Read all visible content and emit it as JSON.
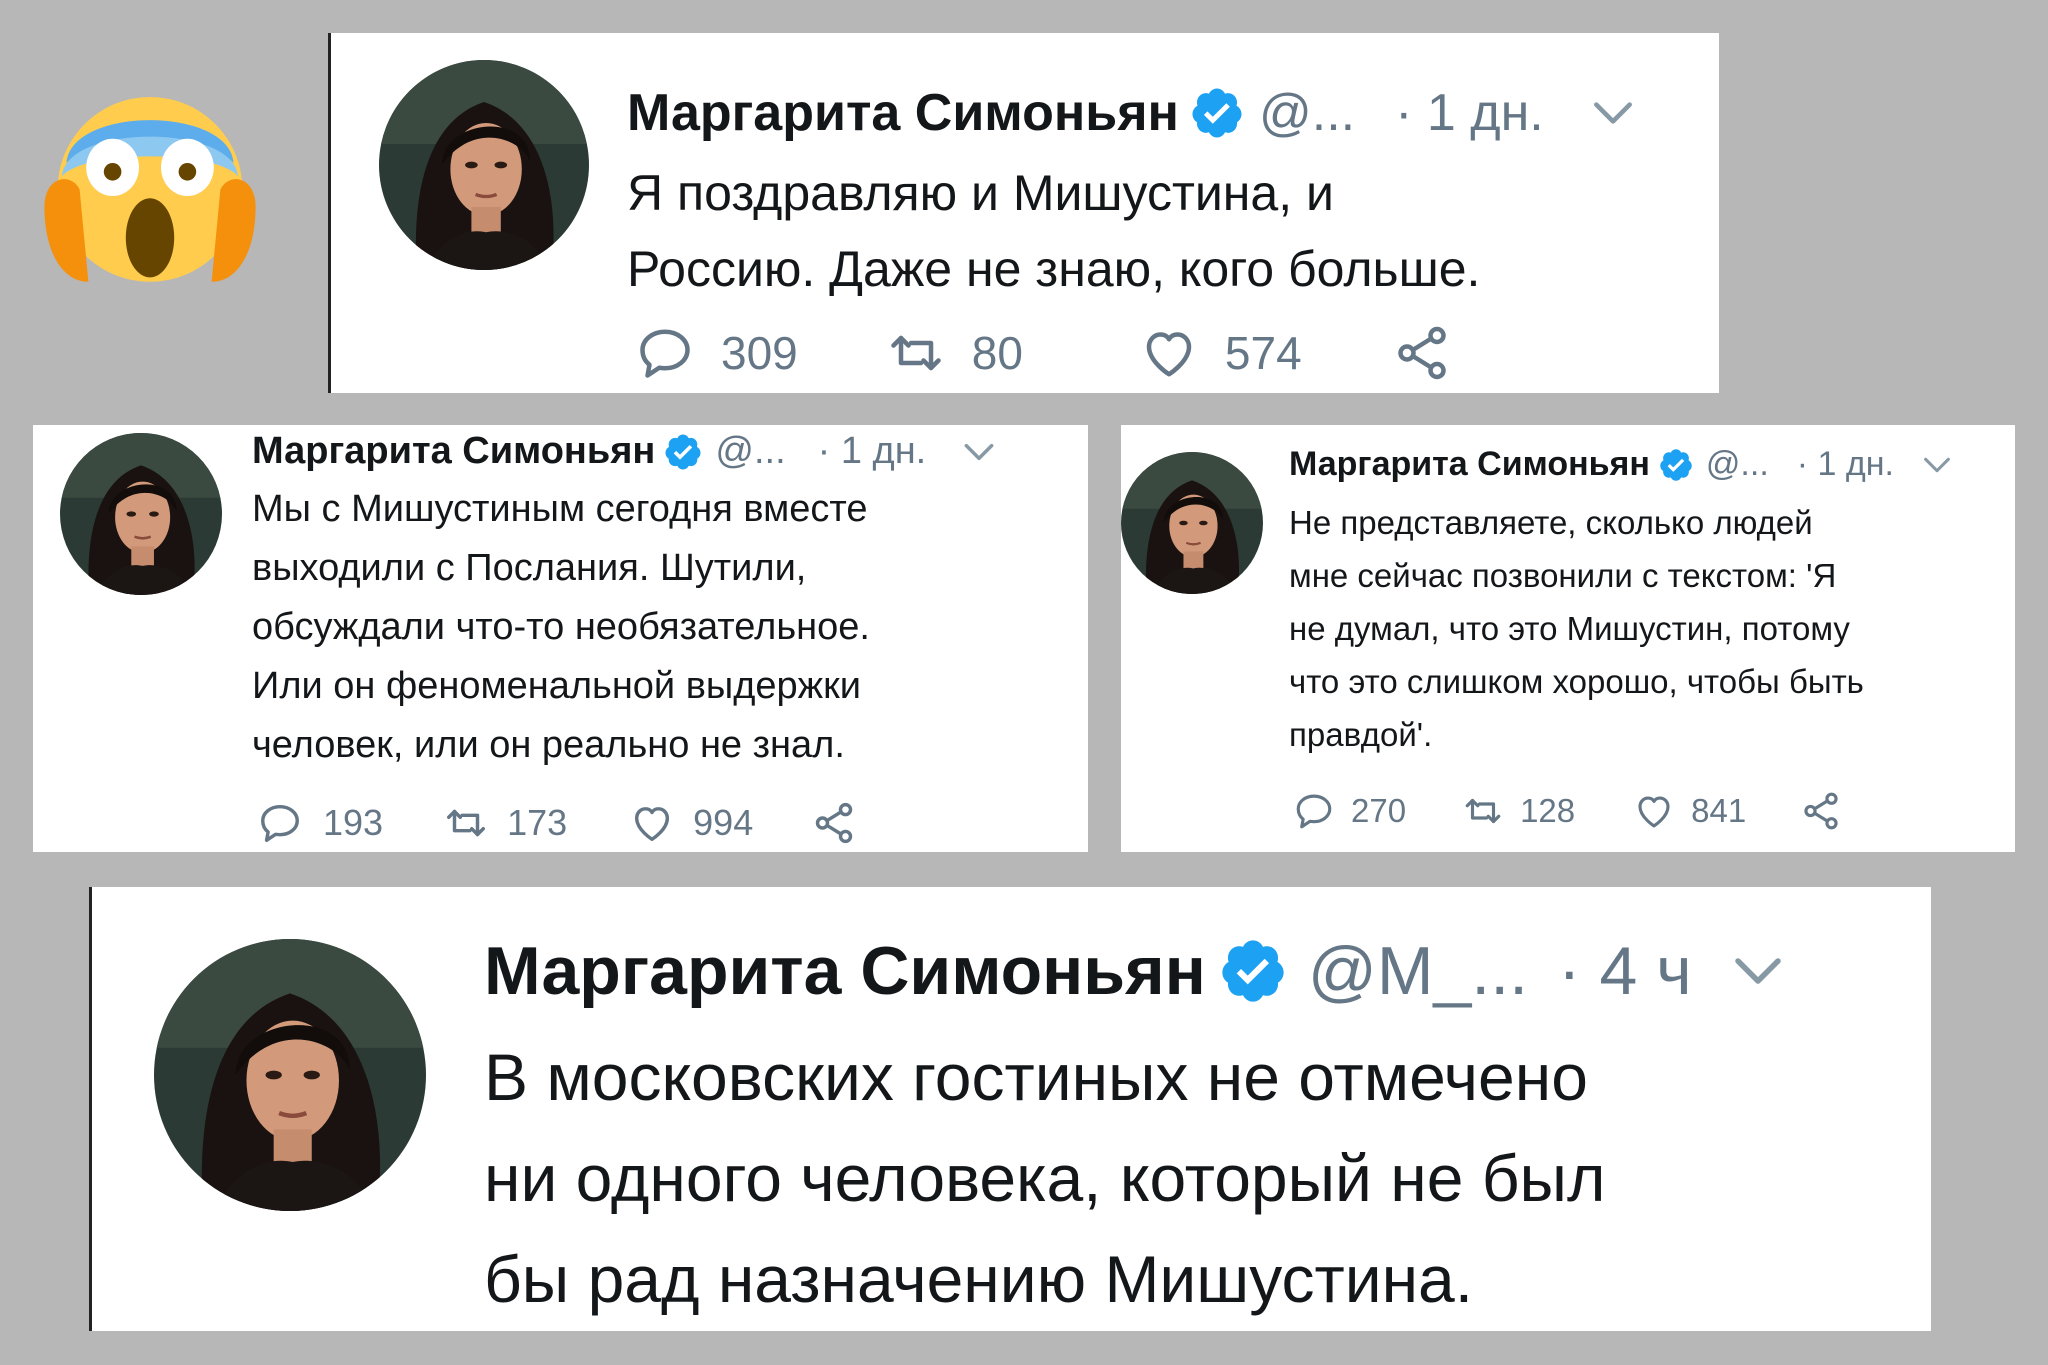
{
  "tweets": [
    {
      "name": "Маргарита Симоньян",
      "handle": "@...",
      "time": "· 1 дн.",
      "lines": [
        "Я поздравляю и Мишустина, и",
        "Россию. Даже не знаю, кого больше."
      ],
      "replies": "309",
      "retweets": "80",
      "likes": "574"
    },
    {
      "name": "Маргарита Симоньян",
      "handle": "@...",
      "time": "· 1 дн.",
      "lines": [
        "Мы с Мишустиным сегодня вместе",
        "выходили с Послания. Шутили,",
        "обсуждали что-то необязательное.",
        "Или он феноменальной выдержки",
        "человек, или он реально не знал."
      ],
      "replies": "193",
      "retweets": "173",
      "likes": "994"
    },
    {
      "name": "Маргарита Симоньян",
      "handle": "@...",
      "time": "· 1 дн.",
      "lines": [
        "Не представляете, сколько людей",
        "мне сейчас позвонили с текстом: 'Я",
        "не думал, что это Мишустин, потому",
        "что это слишком хорошо, чтобы быть",
        "правдой'."
      ],
      "replies": "270",
      "retweets": "128",
      "likes": "841"
    },
    {
      "name": "Маргарита Симоньян",
      "handle": "@M_...",
      "time": "· 4 ч",
      "lines": [
        "В московских гостиных не отмечено",
        "ни одного человека, который не был",
        "бы рад назначению Мишустина."
      ]
    }
  ],
  "colors": {
    "background": "#b7b7b7",
    "card": "#ffffff",
    "verified": "#1da1f2",
    "muted": "#657786",
    "text": "#14171a",
    "emoji_yellow": "#ffcc4d",
    "emoji_blue": "#5dadec",
    "emoji_hands": "#f4900c"
  },
  "icons": [
    "screaming-face-emoji",
    "verified-badge-icon",
    "chevron-down-icon",
    "reply-icon",
    "retweet-icon",
    "like-icon",
    "share-icon"
  ]
}
